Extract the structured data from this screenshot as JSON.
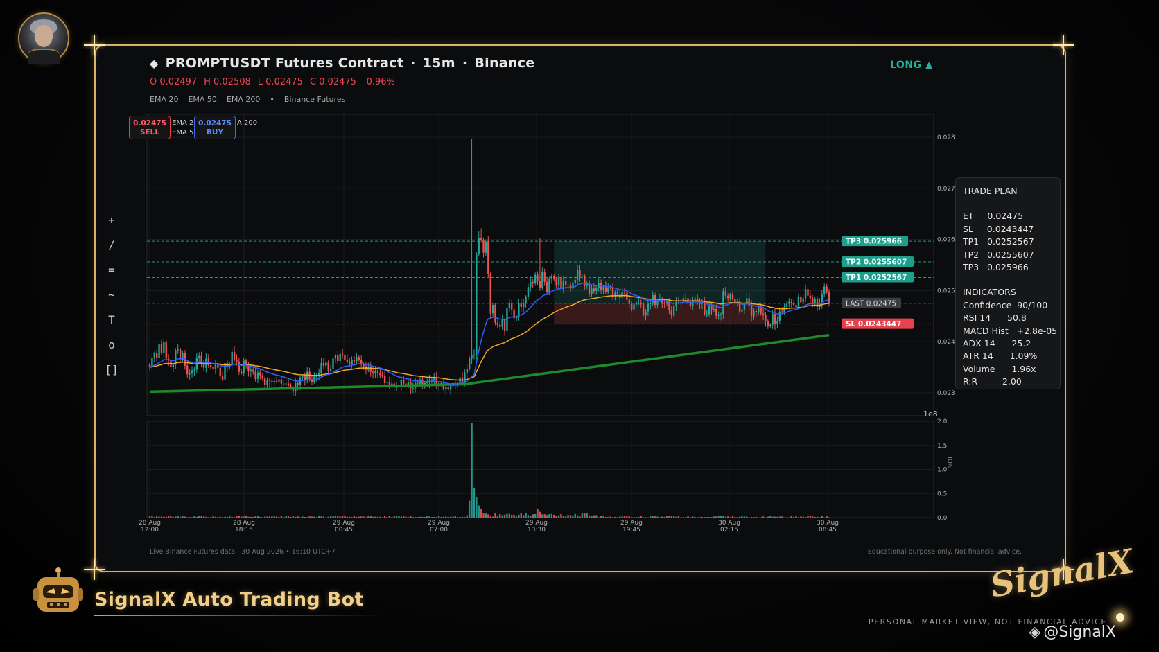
{
  "header": {
    "symbol": "PROMPTUSDT Futures Contract",
    "timeframe": "15m",
    "exchange": "Binance",
    "diamond": "◆",
    "separator": "·",
    "direction": "LONG ▲",
    "ohlc": {
      "open": "O 0.02497",
      "high": "H 0.02508",
      "low": "L 0.02475",
      "close": "C 0.02475",
      "change": "-0.96%"
    },
    "indicators": [
      "EMA 20",
      "EMA 50",
      "EMA 200",
      "•",
      "Binance Futures"
    ]
  },
  "legend_overlap": {
    "a": "EMA 2",
    "b": "EMA 5",
    "c": "A 200"
  },
  "order_buttons": {
    "sell_price": "0.02475",
    "sell_label": "SELL",
    "buy_price": "0.02475",
    "buy_label": "BUY"
  },
  "toolbar": {
    "cross": "+",
    "line": "/",
    "hlines": "=",
    "wave": "~",
    "text": "T",
    "circle": "o",
    "rect": "[]"
  },
  "trade_plan": {
    "title": "TRADE PLAN",
    "levels": [
      "ET     0.02475",
      "SL     0.0243447",
      "TP1   0.0252567",
      "TP2   0.0255607",
      "TP3   0.025966"
    ],
    "indicators_title": "INDICATORS",
    "indicators": [
      "Confidence  90/100",
      "RSI 14      50.8",
      "MACD Hist   +2.8e-05",
      "ADX 14      25.2",
      "ATR 14      1.09%",
      "Volume      1.96x",
      "R:R         2.00"
    ]
  },
  "footer": {
    "left": "Live Binance Futures data  ·  30 Aug 2026 • 16:10 UTC+7",
    "right": "Educational purpose only. Not financial advice."
  },
  "branding": {
    "bot_name": "SignalX Auto Trading Bot",
    "logo_text": "SignalX",
    "disclaimer": "PERSONAL MARKET VIEW, NOT FINANCIAL ADVICE.",
    "handle": "@SignalX"
  },
  "colors": {
    "up": "#26a69a",
    "down": "#ef5350",
    "ema20": "#2962ff",
    "ema50": "#f5a623",
    "ema200": "#1f8a2a",
    "tp": "#26a69a",
    "sl": "#ef4451",
    "last": "#5fa8d3",
    "accent": "#d8b468"
  },
  "chart_data": {
    "type": "candlestick",
    "x_ticks": [
      "28 Aug\n12:00",
      "28 Aug\n18:15",
      "29 Aug\n00:45",
      "29 Aug\n07:00",
      "29 Aug\n13:30",
      "29 Aug\n19:45",
      "30 Aug\n02:15",
      "30 Aug\n08:45"
    ],
    "y_ticks": [
      "0.023",
      "0.024",
      "0.025",
      "0.026",
      "0.027",
      "0.028"
    ],
    "ylim": [
      0.02255,
      0.02845
    ],
    "y_offset_label": "1e8",
    "volume": {
      "y_ticks": [
        "0.0",
        "0.5",
        "1.0",
        "1.5",
        "2.0"
      ],
      "ylim": [
        0,
        2.0
      ],
      "ylabel": "VOL"
    },
    "levels": [
      {
        "name": "TP3",
        "value": 0.025966,
        "label": "TP3  0.025966"
      },
      {
        "name": "TP2",
        "value": 0.0255607,
        "label": "TP2  0.0255607"
      },
      {
        "name": "TP1",
        "value": 0.0252567,
        "label": "TP1  0.0252567"
      },
      {
        "name": "LAST",
        "value": 0.02475,
        "label": "LAST  0.02475"
      },
      {
        "name": "SL",
        "value": 0.0243447,
        "label": "SL  0.0243447"
      }
    ],
    "n_bars": 296,
    "close": [
      0.0235,
      0.02368,
      0.02377,
      0.02368,
      0.02396,
      0.02378,
      0.02399,
      0.02367,
      0.02363,
      0.02351,
      0.02355,
      0.02383,
      0.02385,
      0.02364,
      0.02377,
      0.02353,
      0.02336,
      0.02339,
      0.02344,
      0.02345,
      0.02368,
      0.02372,
      0.02356,
      0.02349,
      0.02367,
      0.02354,
      0.02351,
      0.02347,
      0.02355,
      0.02349,
      0.02332,
      0.02326,
      0.02358,
      0.02351,
      0.02356,
      0.0238,
      0.02365,
      0.02361,
      0.02341,
      0.02339,
      0.02363,
      0.02353,
      0.02342,
      0.02345,
      0.02341,
      0.02327,
      0.0234,
      0.02334,
      0.02328,
      0.02316,
      0.02325,
      0.02323,
      0.02321,
      0.02323,
      0.02322,
      0.02326,
      0.02318,
      0.02317,
      0.02318,
      0.02314,
      0.02309,
      0.02302,
      0.02319,
      0.02315,
      0.0233,
      0.02332,
      0.02325,
      0.02341,
      0.02326,
      0.02321,
      0.02332,
      0.02332,
      0.02338,
      0.02358,
      0.02353,
      0.02359,
      0.02342,
      0.02346,
      0.02367,
      0.02373,
      0.02362,
      0.02376,
      0.02373,
      0.02365,
      0.02361,
      0.02356,
      0.02364,
      0.02362,
      0.0237,
      0.02364,
      0.02355,
      0.02352,
      0.02345,
      0.0235,
      0.02341,
      0.02338,
      0.02342,
      0.02339,
      0.02335,
      0.02334,
      0.02319,
      0.02321,
      0.02314,
      0.02318,
      0.02311,
      0.02311,
      0.02313,
      0.02325,
      0.02318,
      0.02314,
      0.0232,
      0.02309,
      0.02309,
      0.02319,
      0.02318,
      0.02326,
      0.02315,
      0.02319,
      0.0232,
      0.02324,
      0.02324,
      0.0233,
      0.02314,
      0.02319,
      0.02318,
      0.02307,
      0.02311,
      0.02306,
      0.02313,
      0.02319,
      0.02315,
      0.02317,
      0.0233,
      0.02319,
      0.02338,
      0.02347,
      0.02367,
      0.02374,
      0.02375,
      0.02572,
      0.02603,
      0.02599,
      0.02574,
      0.02596,
      0.02532,
      0.02455,
      0.02472,
      0.02437,
      0.02433,
      0.02429,
      0.02443,
      0.02422,
      0.02465,
      0.02475,
      0.02463,
      0.02446,
      0.02448,
      0.02476,
      0.02468,
      0.02476,
      0.02487,
      0.02507,
      0.02517,
      0.02515,
      0.02531,
      0.02519,
      0.02506,
      0.02536,
      0.02517,
      0.02496,
      0.02524,
      0.02528,
      0.02522,
      0.02511,
      0.02526,
      0.02503,
      0.02518,
      0.02511,
      0.02511,
      0.02504,
      0.02514,
      0.02521,
      0.02541,
      0.02527,
      0.02529,
      0.02509,
      0.02515,
      0.02493,
      0.02504,
      0.02499,
      0.02505,
      0.02515,
      0.02501,
      0.02507,
      0.02498,
      0.02506,
      0.02505,
      0.02488,
      0.02496,
      0.02492,
      0.02486,
      0.02498,
      0.02496,
      0.02482,
      0.02474,
      0.02463,
      0.02473,
      0.02475,
      0.02476,
      0.02473,
      0.02452,
      0.02459,
      0.02474,
      0.02475,
      0.02491,
      0.02472,
      0.02481,
      0.02484,
      0.02476,
      0.02475,
      0.02478,
      0.02461,
      0.02451,
      0.02469,
      0.02481,
      0.02479,
      0.02481,
      0.02485,
      0.02485,
      0.02475,
      0.0247,
      0.02482,
      0.02485,
      0.02477,
      0.02474,
      0.02478,
      0.02454,
      0.02454,
      0.02471,
      0.02463,
      0.02464,
      0.02451,
      0.02452,
      0.02454,
      0.02499,
      0.0249,
      0.02485,
      0.02492,
      0.02484,
      0.02477,
      0.02478,
      0.02459,
      0.02463,
      0.02473,
      0.02485,
      0.02471,
      0.0245,
      0.0246,
      0.02457,
      0.0247,
      0.02455,
      0.02452,
      0.0244,
      0.02431,
      0.02433,
      0.02454,
      0.02434,
      0.02441,
      0.02459,
      0.02457,
      0.02468,
      0.02474,
      0.02478,
      0.02475,
      0.02472,
      0.02468,
      0.02487,
      0.02477,
      0.02485,
      0.02503,
      0.0249,
      0.02485,
      0.02475,
      0.02483,
      0.02468,
      0.02475,
      0.02494,
      0.02508,
      0.02497,
      0.02475
    ],
    "notes": "candles approximate; volume spike ~1.96 near 29 Aug 10:00"
  }
}
